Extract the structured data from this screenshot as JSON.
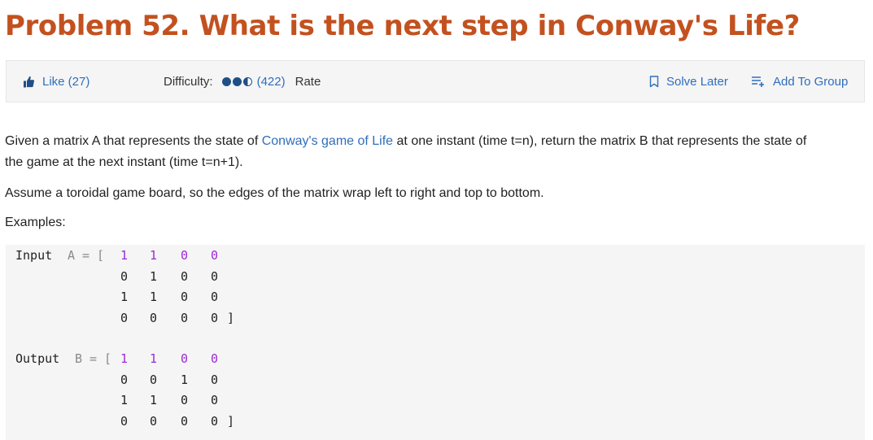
{
  "problem": {
    "title": "Problem 52. What is the next step in Conway's Life?"
  },
  "toolbar": {
    "like_label": "Like (27)",
    "difficulty_label": "Difficulty:",
    "difficulty_level": 2.5,
    "difficulty_max": 3,
    "rating_count": "(422)",
    "rate_label": "Rate",
    "solve_later_label": "Solve Later",
    "add_group_label": "Add To Group",
    "colors": {
      "link": "#2f6ebd",
      "dot": "#1f4f86",
      "title": "#c3511f"
    }
  },
  "description": {
    "p1_before": "Given a matrix A that represents the state of ",
    "p1_link": "Conway's game of Life",
    "p1_after": " at one instant (time t=n), return the matrix B that represents the state of the game at the next instant (time t=n+1).",
    "p2": "Assume a toroidal game board, so the edges of the matrix wrap left to right and top to bottom.",
    "examples_label": "Examples:"
  },
  "example": {
    "input": {
      "keyword": "Input",
      "var": "A",
      "eq": "=",
      "open": "[",
      "close": "]",
      "rows": [
        [
          "1",
          "1",
          "0",
          "0"
        ],
        [
          "0",
          "1",
          "0",
          "0"
        ],
        [
          "1",
          "1",
          "0",
          "0"
        ],
        [
          "0",
          "0",
          "0",
          "0"
        ]
      ]
    },
    "output": {
      "keyword": "Output",
      "var": "B",
      "eq": "=",
      "open": "[",
      "close": "]",
      "rows": [
        [
          "1",
          "1",
          "0",
          "0"
        ],
        [
          "0",
          "0",
          "1",
          "0"
        ],
        [
          "1",
          "1",
          "0",
          "0"
        ],
        [
          "0",
          "0",
          "0",
          "0"
        ]
      ]
    }
  }
}
